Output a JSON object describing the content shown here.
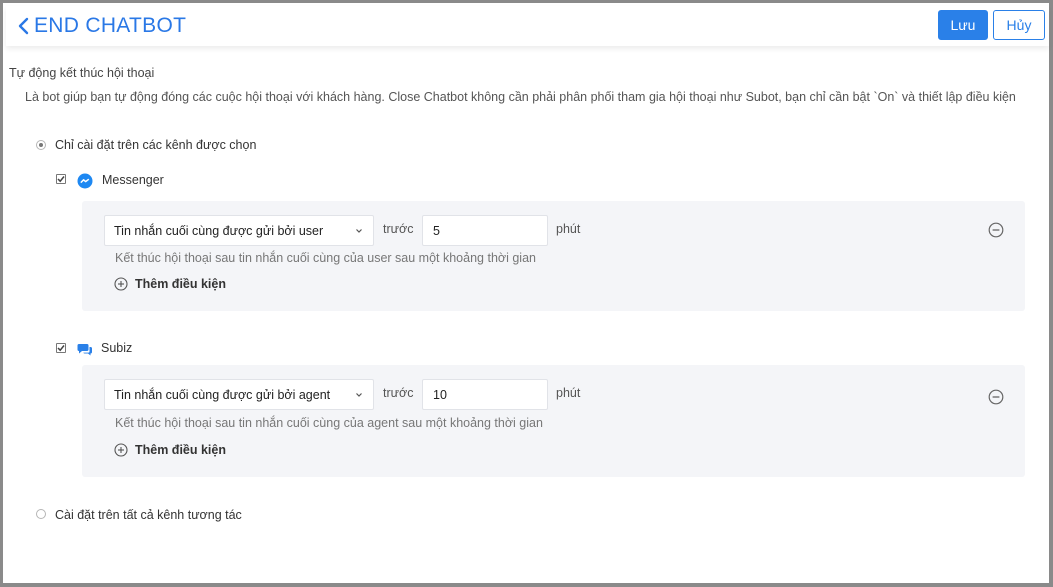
{
  "header": {
    "title": "END CHATBOT",
    "save_label": "Lưu",
    "cancel_label": "Hủy"
  },
  "section": {
    "title": "Tự động kết thúc hội thoại",
    "description": "Là bot giúp bạn tự động đóng các cuộc hội thoại với khách hàng. Close Chatbot không cần phải phân phối tham gia hội thoại như Subot, bạn chỉ cần bật `On` và thiết lập điều kiện"
  },
  "options": {
    "selected_channels_label": "Chỉ cài đặt trên các kênh được chọn",
    "selected_channels_checked": true,
    "all_channels_label": "Cài đặt trên tất cả kênh tương tác",
    "all_channels_checked": false
  },
  "channels": [
    {
      "name": "Messenger",
      "icon": "messenger-icon",
      "checked": true,
      "condition": {
        "select_value": "Tin nhắn cuối cùng được gửi bởi user",
        "before_label": "trước",
        "value": "5",
        "unit": "phút",
        "hint": "Kết thúc hội thoại sau tin nhắn cuối cùng của user sau một khoảng thời gian"
      },
      "add_condition_label": "Thêm điều kiện"
    },
    {
      "name": "Subiz",
      "icon": "chat-bubbles-icon",
      "checked": true,
      "condition": {
        "select_value": "Tin nhắn cuối cùng được gửi bởi agent",
        "before_label": "trước",
        "value": "10",
        "unit": "phút",
        "hint": "Kết thúc hội thoại sau tin nhắn cuối cùng của agent sau một khoảng thời gian"
      },
      "add_condition_label": "Thêm điều kiện"
    }
  ],
  "colors": {
    "accent": "#2a80e8",
    "title": "#2a78e6",
    "panel_bg": "#f4f5f8"
  }
}
